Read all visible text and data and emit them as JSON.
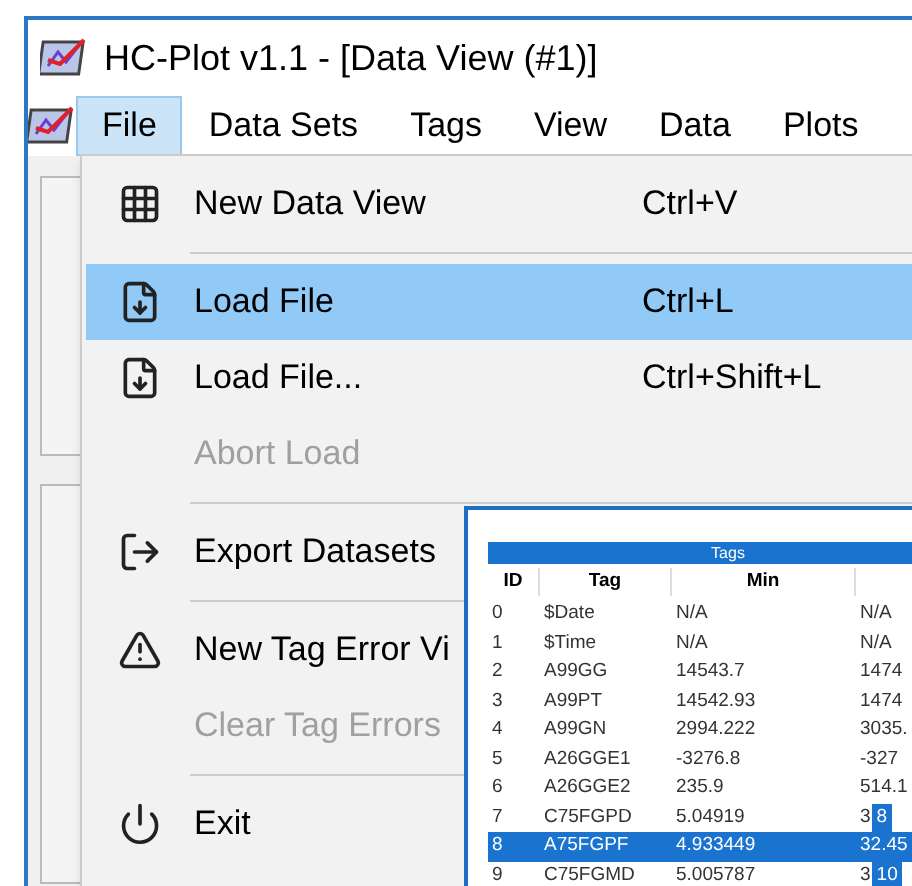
{
  "window": {
    "title": "HC-Plot v1.1 - [Data View (#1)]"
  },
  "menu_bar": [
    {
      "label": "File",
      "selected": true
    },
    {
      "label": "Data Sets",
      "selected": false
    },
    {
      "label": "Tags",
      "selected": false
    },
    {
      "label": "View",
      "selected": false
    },
    {
      "label": "Data",
      "selected": false
    },
    {
      "label": "Plots",
      "selected": false
    }
  ],
  "file_menu": [
    {
      "kind": "item",
      "label": "New Data View",
      "shortcut": "Ctrl+V",
      "disabled": false,
      "selected": false
    },
    {
      "kind": "separator"
    },
    {
      "kind": "item",
      "label": "Load File",
      "shortcut": "Ctrl+L",
      "disabled": false,
      "selected": true
    },
    {
      "kind": "item",
      "label": "Load File...",
      "shortcut": "Ctrl+Shift+L",
      "disabled": false,
      "selected": false
    },
    {
      "kind": "item",
      "label": "Abort Load",
      "disabled": true,
      "selected": false
    },
    {
      "kind": "separator"
    },
    {
      "kind": "item",
      "label": "Export Datasets",
      "disabled": false,
      "selected": false
    },
    {
      "kind": "separator"
    },
    {
      "kind": "item",
      "label": "New Tag Error Vi",
      "disabled": false,
      "selected": false
    },
    {
      "kind": "item",
      "label": "Clear Tag Errors",
      "disabled": true,
      "selected": false
    },
    {
      "kind": "separator"
    },
    {
      "kind": "item",
      "label": "Exit",
      "disabled": false,
      "selected": false
    }
  ],
  "tags_window": {
    "title": "Tags",
    "columns": [
      "ID",
      "Tag",
      "Min"
    ],
    "rows": [
      {
        "cells": [
          "0",
          "$Date",
          "N/A",
          "N/A"
        ],
        "selected": false
      },
      {
        "cells": [
          "1",
          "$Time",
          "N/A",
          "N/A"
        ],
        "selected": false
      },
      {
        "cells": [
          "2",
          "A99GG",
          "14543.7",
          "1474"
        ],
        "selected": false
      },
      {
        "cells": [
          "3",
          "A99PT",
          "14542.93",
          "1474"
        ],
        "selected": false
      },
      {
        "cells": [
          "4",
          "A99GN",
          "2994.222",
          "3035."
        ],
        "selected": false
      },
      {
        "cells": [
          "5",
          "A26GGE1",
          "-3276.8",
          "-327"
        ],
        "selected": false
      },
      {
        "cells": [
          "6",
          "A26GGE2",
          "235.9",
          "514.1"
        ],
        "selected": false
      },
      {
        "cells": [
          "7",
          "C75FGPD",
          "5.04919",
          "3"
        ],
        "selected": false,
        "badge": "8"
      },
      {
        "cells": [
          "8",
          "A75FGPF",
          "4.933449",
          "32.45"
        ],
        "selected": true
      },
      {
        "cells": [
          "9",
          "C75FGMD",
          "5.005787",
          "3"
        ],
        "selected": false,
        "badge": "10"
      }
    ]
  }
}
